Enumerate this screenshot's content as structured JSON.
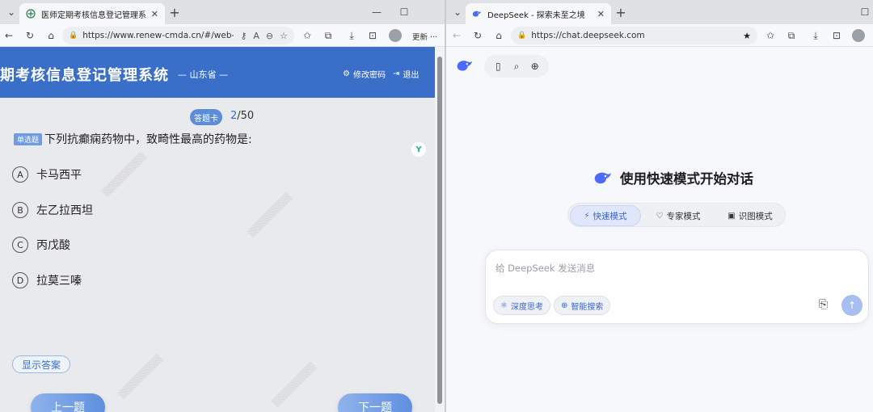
{
  "left_window": {
    "tab": {
      "title": "医师定期考核信息登记管理系统",
      "close": "✕"
    },
    "new_tab": "+",
    "window_controls": {
      "minimize": "—",
      "maximize": "☐"
    },
    "address_bar": {
      "url": "https://www.renew-cmda.cn/#/web-..."
    },
    "update_label": "更新",
    "more_label": "···",
    "page": {
      "system_title": "期考核信息登记管理系统",
      "province": "— 山东省 —",
      "change_password": "修改密码",
      "logout": "退出",
      "answer_sheet": "答题卡",
      "progress_current": "2",
      "progress_total": "/50",
      "question_type": "单选题",
      "question_text": "下列抗癫痫药物中，致畸性最高的药物是:",
      "options": [
        {
          "letter": "A",
          "text": "卡马西平"
        },
        {
          "letter": "B",
          "text": "左乙拉西坦"
        },
        {
          "letter": "C",
          "text": "丙戊酸"
        },
        {
          "letter": "D",
          "text": "拉莫三嗪"
        }
      ],
      "show_answer": "显示答案",
      "prev": "上一题",
      "next": "下一题"
    }
  },
  "right_window": {
    "tab": {
      "title": "DeepSeek - 探索未至之境",
      "close": "✕"
    },
    "new_tab": "+",
    "address_bar": {
      "url": "https://chat.deepseek.com"
    },
    "page": {
      "greeting": "使用快速模式开始对话",
      "modes": [
        {
          "icon": "⚡",
          "label": "快速模式",
          "active": true
        },
        {
          "icon": "♡",
          "label": "专家模式",
          "active": false
        },
        {
          "icon": "▣",
          "label": "识图模式",
          "active": false
        }
      ],
      "input_placeholder": "给 DeepSeek 发送消息",
      "deep_think": "深度思考",
      "web_search": "智能搜索"
    }
  },
  "colors": {
    "header_blue": "#3a6fc9",
    "deepseek_blue": "#4d6bfe",
    "send_button": "#a7bef0"
  }
}
